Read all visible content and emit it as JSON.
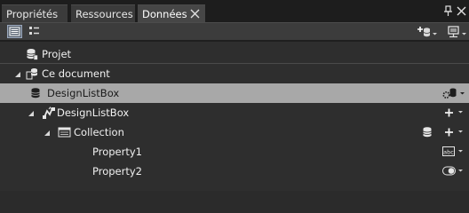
{
  "tabs": [
    {
      "label": "Propriétés"
    },
    {
      "label": "Ressources"
    },
    {
      "label": "Données"
    }
  ],
  "tree": {
    "project": {
      "label": "Projet"
    },
    "document": {
      "label": "Ce document"
    },
    "source": {
      "label": "DesignListBox"
    },
    "object": {
      "label": "DesignListBox"
    },
    "collection": {
      "label": "Collection"
    },
    "property1": {
      "label": "Property1",
      "type_icon": "abc"
    },
    "property2": {
      "label": "Property2",
      "type_icon": "toggle"
    }
  },
  "colors": {
    "background": "#2e2e2e",
    "tabbar": "#1d1d1d",
    "selection": "#a8a8a8",
    "text": "#f0f0f0"
  }
}
